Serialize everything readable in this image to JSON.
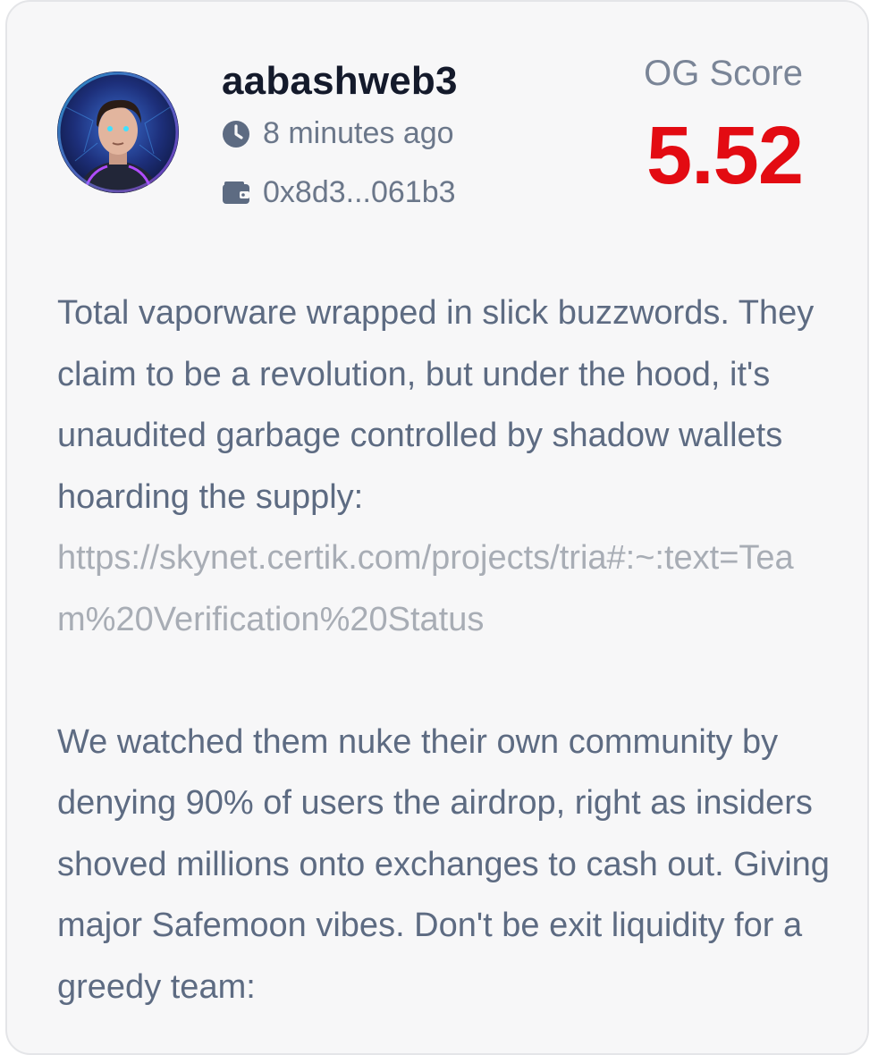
{
  "post": {
    "username": "aabashweb3",
    "time": "8 minutes ago",
    "wallet": "0x8d3...061b3",
    "score_label": "OG Score",
    "score_value": "5.52",
    "paragraph1": "Total vaporware wrapped in slick buzzwords. They claim to be a revolution, but under the hood, it's unaudited garbage controlled by shadow wallets hoarding the supply:",
    "link1": "https://skynet.certik.com/projects/tria#:~:text=Team%20Verification%20Status",
    "paragraph2": "We watched them nuke their own community by denying 90% of users the airdrop, right as insiders shoved millions onto exchanges to cash out. Giving major Safemoon vibes. Don't be exit liquidity for a greedy team:"
  },
  "icons": {
    "time": "clock-icon",
    "wallet": "wallet-icon"
  },
  "colors": {
    "score": "#e30b12",
    "username": "#141a2b",
    "body_text": "#5d6b82",
    "link": "#a8adb5",
    "card_bg": "#f7f7f8"
  }
}
